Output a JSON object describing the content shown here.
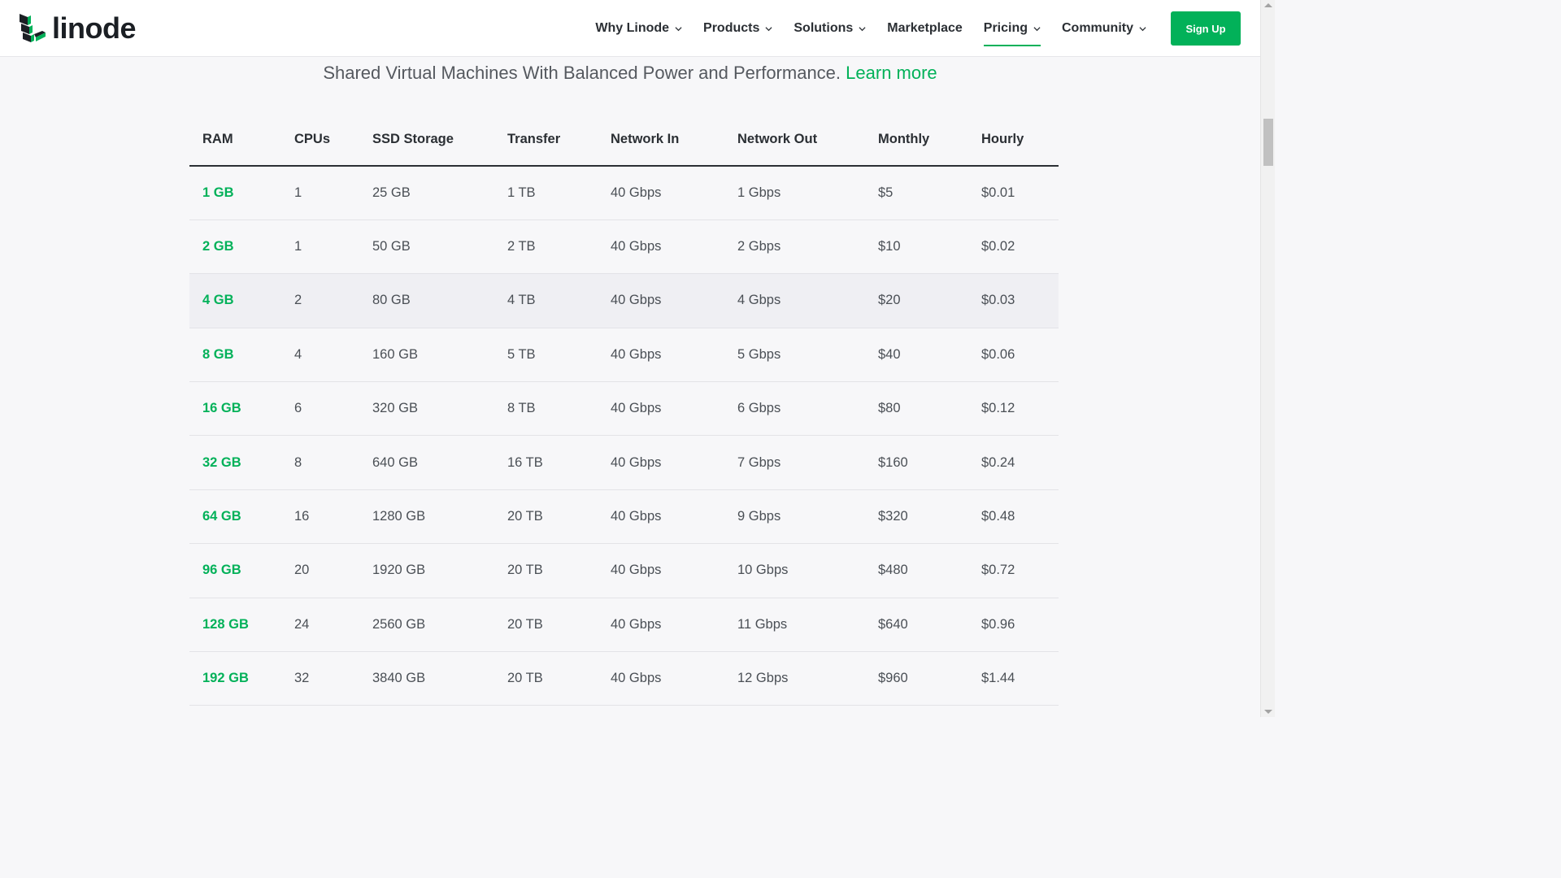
{
  "brand": {
    "name": "linode",
    "accent": "#02b159",
    "dark": "#1b1f24"
  },
  "nav": {
    "items": [
      {
        "label": "Why Linode",
        "has_dropdown": true
      },
      {
        "label": "Products",
        "has_dropdown": true
      },
      {
        "label": "Solutions",
        "has_dropdown": true
      },
      {
        "label": "Marketplace",
        "has_dropdown": false
      },
      {
        "label": "Pricing",
        "has_dropdown": true,
        "active": true
      },
      {
        "label": "Community",
        "has_dropdown": true
      }
    ],
    "signup_label": "Sign Up"
  },
  "tagline": {
    "text": "Shared Virtual Machines With Balanced Power and Performance.",
    "link": "Learn more"
  },
  "table": {
    "headers": [
      "RAM",
      "CPUs",
      "SSD Storage",
      "Transfer",
      "Network In",
      "Network Out",
      "Monthly",
      "Hourly"
    ],
    "rows": [
      [
        "1 GB",
        "1",
        "25 GB",
        "1 TB",
        "40 Gbps",
        "1 Gbps",
        "$5",
        "$0.01"
      ],
      [
        "2 GB",
        "1",
        "50 GB",
        "2 TB",
        "40 Gbps",
        "2 Gbps",
        "$10",
        "$0.02"
      ],
      [
        "4 GB",
        "2",
        "80 GB",
        "4 TB",
        "40 Gbps",
        "4 Gbps",
        "$20",
        "$0.03"
      ],
      [
        "8 GB",
        "4",
        "160 GB",
        "5 TB",
        "40 Gbps",
        "5 Gbps",
        "$40",
        "$0.06"
      ],
      [
        "16 GB",
        "6",
        "320 GB",
        "8 TB",
        "40 Gbps",
        "6 Gbps",
        "$80",
        "$0.12"
      ],
      [
        "32 GB",
        "8",
        "640 GB",
        "16 TB",
        "40 Gbps",
        "7 Gbps",
        "$160",
        "$0.24"
      ],
      [
        "64 GB",
        "16",
        "1280 GB",
        "20 TB",
        "40 Gbps",
        "9 Gbps",
        "$320",
        "$0.48"
      ],
      [
        "96 GB",
        "20",
        "1920 GB",
        "20 TB",
        "40 Gbps",
        "10 Gbps",
        "$480",
        "$0.72"
      ],
      [
        "128 GB",
        "24",
        "2560 GB",
        "20 TB",
        "40 Gbps",
        "11 Gbps",
        "$640",
        "$0.96"
      ],
      [
        "192 GB",
        "32",
        "3840 GB",
        "20 TB",
        "40 Gbps",
        "12 Gbps",
        "$960",
        "$1.44"
      ]
    ],
    "highlighted_row": 2
  },
  "icons": {
    "logo": "linode-logo-icon",
    "dropdown": "chevron-down-icon"
  }
}
